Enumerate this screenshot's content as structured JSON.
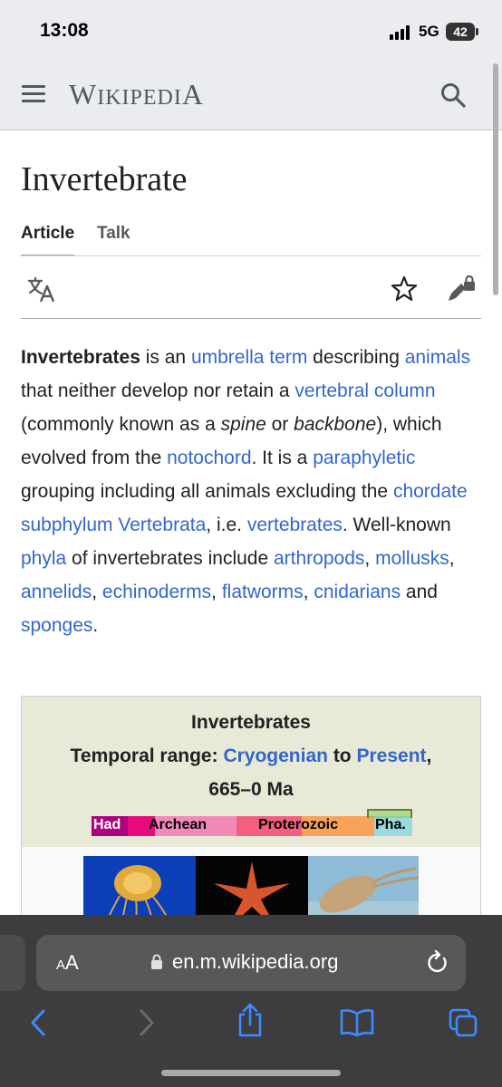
{
  "status_bar": {
    "time": "13:08",
    "network": "5G",
    "battery": "42"
  },
  "header": {
    "logo_first": "W",
    "logo_middle": "IKIPEDI",
    "logo_last": "A"
  },
  "article": {
    "title": "Invertebrate",
    "tabs": [
      {
        "label": "Article",
        "active": true
      },
      {
        "label": "Talk",
        "active": false
      }
    ],
    "paragraph": [
      {
        "text": "Invertebrates",
        "bold": true
      },
      {
        "text": " is an "
      },
      {
        "text": "umbrella term",
        "link": true
      },
      {
        "text": " describing "
      },
      {
        "text": "animals",
        "link": true
      },
      {
        "text": " that neither develop nor retain a "
      },
      {
        "text": "vertebral column",
        "link": true
      },
      {
        "text": " (commonly known as a "
      },
      {
        "text": "spine",
        "italic": true
      },
      {
        "text": " or "
      },
      {
        "text": "backbone",
        "italic": true
      },
      {
        "text": "), which evolved from the "
      },
      {
        "text": "notochord",
        "link": true
      },
      {
        "text": ". It is a "
      },
      {
        "text": "paraphyletic",
        "link": true
      },
      {
        "text": " grouping including all animals excluding the "
      },
      {
        "text": "chordate subphylum Vertebrata",
        "link": true
      },
      {
        "text": ", i.e. "
      },
      {
        "text": "vertebrates",
        "link": true
      },
      {
        "text": ". Well-known "
      },
      {
        "text": "phyla",
        "link": true
      },
      {
        "text": " of invertebrates include "
      },
      {
        "text": "arthropods",
        "link": true
      },
      {
        "text": ", "
      },
      {
        "text": "mollusks",
        "link": true
      },
      {
        "text": ", "
      },
      {
        "text": "annelids",
        "link": true
      },
      {
        "text": ", "
      },
      {
        "text": "echinoderms",
        "link": true
      },
      {
        "text": ", "
      },
      {
        "text": "flatworms",
        "link": true
      },
      {
        "text": ", "
      },
      {
        "text": "cnidarians",
        "link": true
      },
      {
        "text": " and "
      },
      {
        "text": "sponges",
        "link": true
      },
      {
        "text": "."
      }
    ]
  },
  "infobox": {
    "title": "Invertebrates",
    "temporal_label": "Temporal range:",
    "range_start": "Cryogenian",
    "range_to": " to ",
    "range_end": "Present",
    "range_comma": ",",
    "range_ma": "665–0 Ma",
    "timescale": {
      "had": "Had",
      "archean": "Archean",
      "proterozoic": "Proterozoic",
      "pha": "Pha."
    },
    "colors": {
      "head_bg": "#e9e9d8",
      "hadean": "#ae027e",
      "archean": "#f0047f",
      "proterozoic": "#f73563",
      "phanerozoic": "#9ad9dd"
    }
  },
  "browser": {
    "aa_large": "A",
    "aa_small": "A",
    "url": "en.m.wikipedia.org",
    "accent": "#3d8bff"
  }
}
